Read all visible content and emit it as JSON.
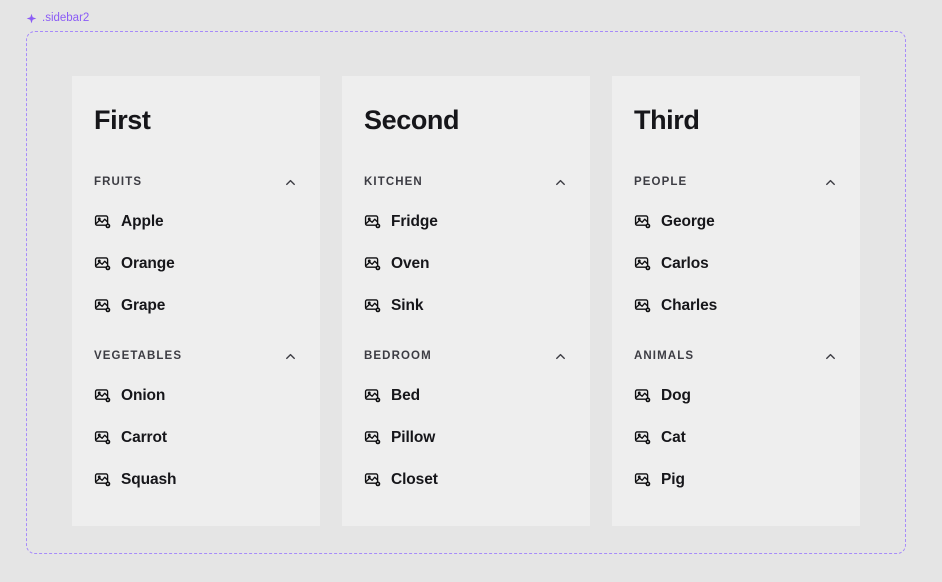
{
  "selection": {
    "label": ".sidebar2",
    "icon": "sparkle-icon",
    "accent_color": "#8b5cf6",
    "border_color": "#a78bfa"
  },
  "theme": {
    "canvas_background": "#e5e5e5",
    "panel_background": "#eeeeee",
    "title_color": "#16161a",
    "group_label_color": "#3c3c43",
    "item_label_color": "#16161a"
  },
  "columns": [
    {
      "title": "First",
      "groups": [
        {
          "label": "FRUITS",
          "toggle_icon": "chevron-up-icon",
          "expanded": true,
          "items": [
            {
              "label": "Apple",
              "icon": "image-icon"
            },
            {
              "label": "Orange",
              "icon": "image-icon"
            },
            {
              "label": "Grape",
              "icon": "image-icon"
            }
          ]
        },
        {
          "label": "VEGETABLES",
          "toggle_icon": "chevron-up-icon",
          "expanded": true,
          "items": [
            {
              "label": "Onion",
              "icon": "image-icon"
            },
            {
              "label": "Carrot",
              "icon": "image-icon"
            },
            {
              "label": "Squash",
              "icon": "image-icon"
            }
          ]
        }
      ]
    },
    {
      "title": "Second",
      "groups": [
        {
          "label": "KITCHEN",
          "toggle_icon": "chevron-up-icon",
          "expanded": true,
          "items": [
            {
              "label": "Fridge",
              "icon": "image-icon"
            },
            {
              "label": "Oven",
              "icon": "image-icon"
            },
            {
              "label": "Sink",
              "icon": "image-icon"
            }
          ]
        },
        {
          "label": "BEDROOM",
          "toggle_icon": "chevron-up-icon",
          "expanded": true,
          "items": [
            {
              "label": "Bed",
              "icon": "image-icon"
            },
            {
              "label": "Pillow",
              "icon": "image-icon"
            },
            {
              "label": "Closet",
              "icon": "image-icon"
            }
          ]
        }
      ]
    },
    {
      "title": "Third",
      "groups": [
        {
          "label": "PEOPLE",
          "toggle_icon": "chevron-up-icon",
          "expanded": true,
          "items": [
            {
              "label": "George",
              "icon": "image-icon"
            },
            {
              "label": "Carlos",
              "icon": "image-icon"
            },
            {
              "label": "Charles",
              "icon": "image-icon"
            }
          ]
        },
        {
          "label": "ANIMALS",
          "toggle_icon": "chevron-up-icon",
          "expanded": true,
          "items": [
            {
              "label": "Dog",
              "icon": "image-icon"
            },
            {
              "label": "Cat",
              "icon": "image-icon"
            },
            {
              "label": "Pig",
              "icon": "image-icon"
            }
          ]
        }
      ]
    }
  ]
}
